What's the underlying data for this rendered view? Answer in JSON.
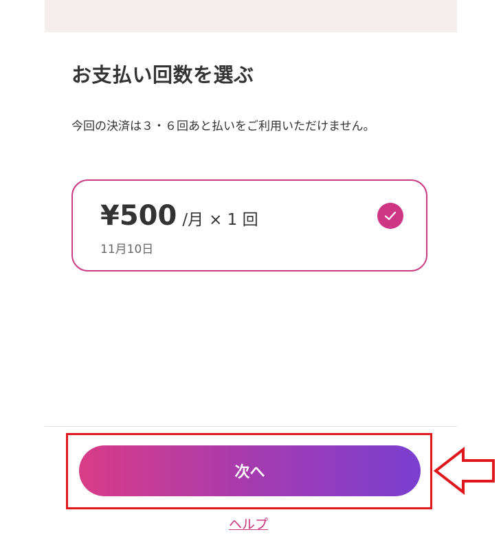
{
  "header": {
    "title": "お支払い回数を選ぶ",
    "notice": "今回の決済は３・６回あと払いをご利用いただけません。"
  },
  "option": {
    "amount": "¥500",
    "per_unit": "/月",
    "times": "× 1 回",
    "date": "11月10日",
    "selected": true
  },
  "actions": {
    "next_label": "次へ",
    "help_label": "ヘルプ"
  },
  "colors": {
    "accent": "#cf3585",
    "annotation": "#e0161d"
  }
}
